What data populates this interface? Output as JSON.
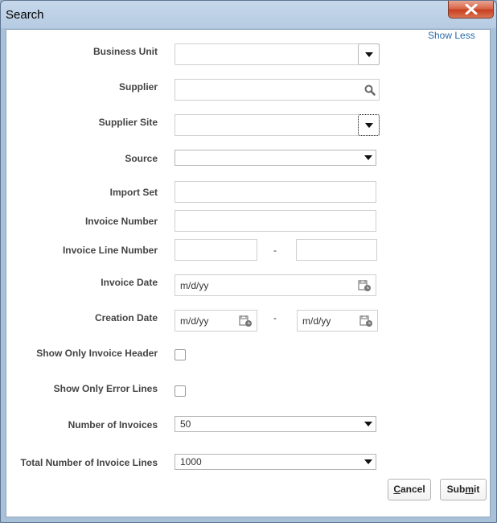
{
  "window": {
    "title": "Search",
    "close_icon": "close-x-icon"
  },
  "links": {
    "show_less": "Show Less"
  },
  "fields": {
    "business_unit": {
      "label": "Business Unit",
      "value": ""
    },
    "supplier": {
      "label": "Supplier",
      "value": "",
      "icon": "search-icon"
    },
    "supplier_site": {
      "label": "Supplier Site",
      "value": ""
    },
    "source": {
      "label": "Source",
      "value": ""
    },
    "import_set": {
      "label": "Import Set",
      "value": ""
    },
    "invoice_number": {
      "label": "Invoice Number",
      "value": ""
    },
    "invoice_line_number": {
      "label": "Invoice Line Number",
      "from": "",
      "to": "",
      "separator": "-"
    },
    "invoice_date": {
      "label": "Invoice Date",
      "value": "m/d/yy",
      "icon": "calendar-icon"
    },
    "creation_date": {
      "label": "Creation Date",
      "from": "m/d/yy",
      "to": "m/d/yy",
      "separator": "-",
      "icon": "calendar-icon"
    },
    "show_only_invoice_header": {
      "label": "Show Only Invoice Header",
      "checked": false
    },
    "show_only_error_lines": {
      "label": "Show Only Error Lines",
      "checked": false
    },
    "number_of_invoices": {
      "label": "Number of Invoices",
      "value": "50"
    },
    "total_number_of_invoice_lines": {
      "label": "Total Number of Invoice Lines",
      "value": "1000"
    }
  },
  "buttons": {
    "cancel_prefix": "",
    "cancel_mnemonic": "C",
    "cancel_rest": "ancel",
    "submit_prefix": "Sub",
    "submit_mnemonic": "m",
    "submit_rest": "it"
  }
}
